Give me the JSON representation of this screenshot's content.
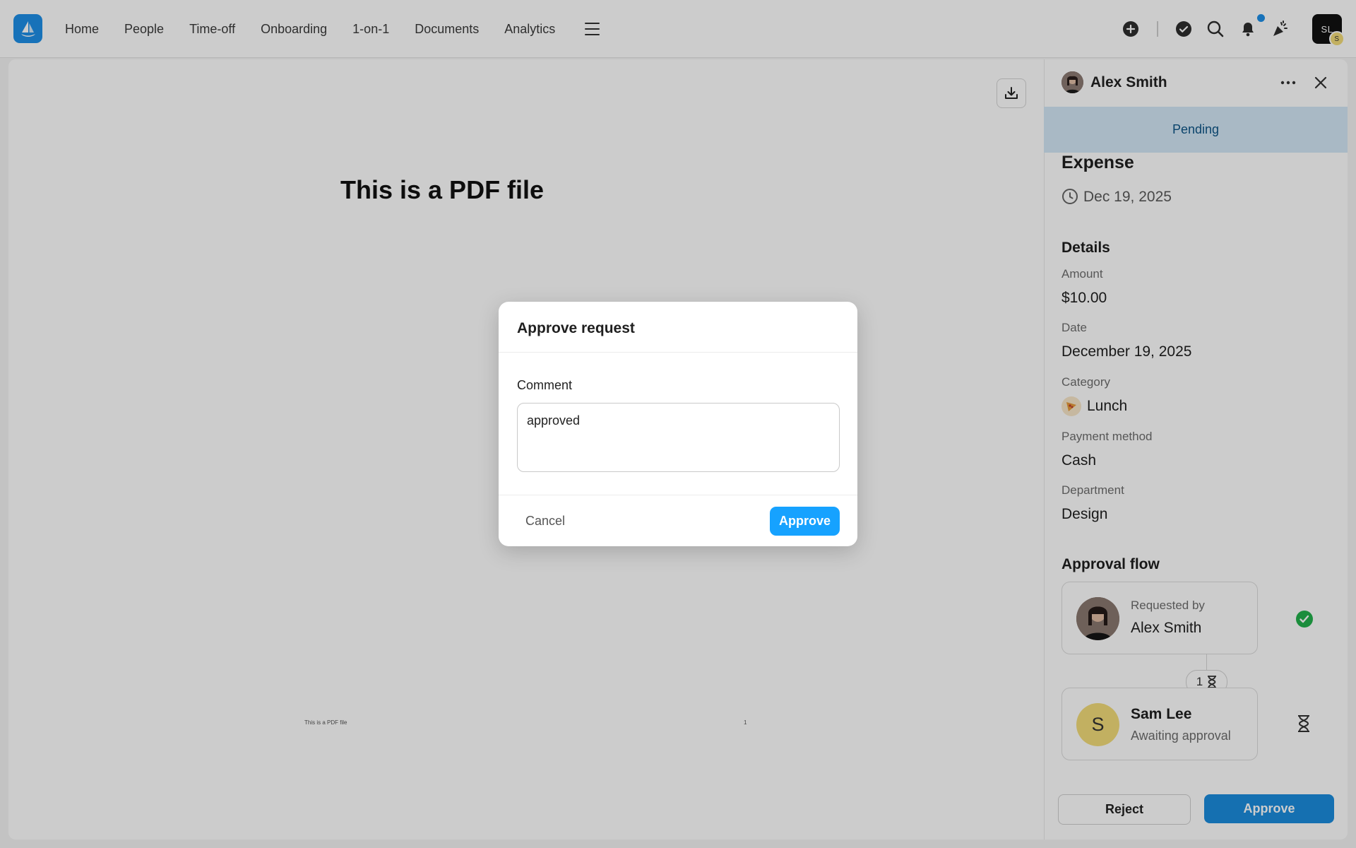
{
  "nav": {
    "items": [
      "Home",
      "People",
      "Time-off",
      "Onboarding",
      "1-on-1",
      "Documents",
      "Analytics"
    ],
    "icons": [
      "add-circle-icon",
      "check-circle-icon",
      "search-icon",
      "bell-icon",
      "celebration-icon"
    ]
  },
  "user": {
    "initials": "SL",
    "badge": "S"
  },
  "document": {
    "title": "This is a PDF file",
    "footer_left": "This is a PDF file",
    "footer_page": "1"
  },
  "panel": {
    "requester": "Alex Smith",
    "status": "Pending",
    "type": "Expense",
    "date": "Dec 19, 2025",
    "details_heading": "Details",
    "fields": {
      "amount_label": "Amount",
      "amount": "$10.00",
      "date_label": "Date",
      "date": "December 19, 2025",
      "category_label": "Category",
      "category": "Lunch",
      "payment_label": "Payment method",
      "payment": "Cash",
      "department_label": "Department",
      "department": "Design"
    },
    "approval_flow": {
      "heading": "Approval flow",
      "requested_by_label": "Requested by",
      "requested_by": "Alex Smith",
      "step_count": "1",
      "approver_initial": "S",
      "approver": "Sam Lee",
      "approver_status": "Awaiting approval"
    },
    "reject_label": "Reject",
    "approve_label": "Approve"
  },
  "modal": {
    "title": "Approve request",
    "comment_label": "Comment",
    "comment_value": "approved",
    "cancel_label": "Cancel",
    "approve_label": "Approve"
  },
  "colors": {
    "accent": "#16a2ff",
    "brand": "#1d8fe8",
    "status_bg": "#d4e8f7",
    "success": "#22b14c"
  }
}
